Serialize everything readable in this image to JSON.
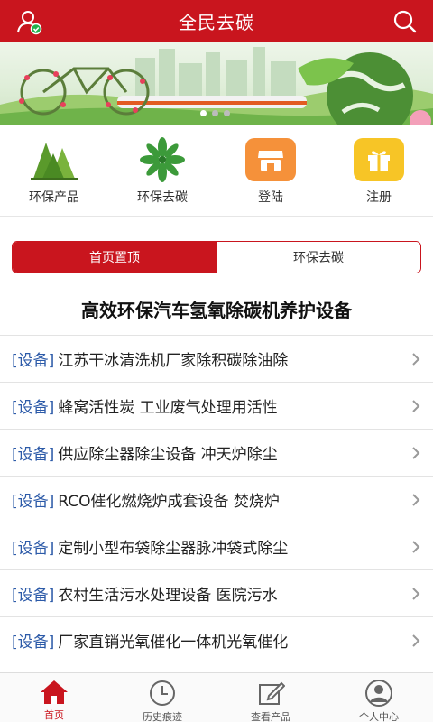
{
  "header": {
    "title": "全民去碳"
  },
  "quick_entries": [
    {
      "label": "环保产品",
      "icon": "trees-icon"
    },
    {
      "label": "环保去碳",
      "icon": "leaf-burst-icon"
    },
    {
      "label": "登陆",
      "icon": "store-icon",
      "color": "#f5913a"
    },
    {
      "label": "注册",
      "icon": "gift-icon",
      "color": "#f7c526"
    }
  ],
  "tabs": [
    {
      "label": "首页置顶",
      "active": true
    },
    {
      "label": "环保去碳",
      "active": false
    }
  ],
  "headline": "高效环保汽车氢氧除碳机养护设备",
  "list": [
    {
      "tag": "[设备]",
      "text": "江苏干冰清洗机厂家除积碳除油除"
    },
    {
      "tag": "[设备]",
      "text": "蜂窝活性炭 工业废气处理用活性"
    },
    {
      "tag": "[设备]",
      "text": "供应除尘器除尘设备 冲天炉除尘"
    },
    {
      "tag": "[设备]",
      "text": "RCO催化燃烧炉成套设备 焚烧炉"
    },
    {
      "tag": "[设备]",
      "text": "定制小型布袋除尘器脉冲袋式除尘"
    },
    {
      "tag": "[设备]",
      "text": "农村生活污水处理设备 医院污水"
    },
    {
      "tag": "[设备]",
      "text": "厂家直销光氧催化一体机光氧催化"
    }
  ],
  "bottom_nav": [
    {
      "label": "首页",
      "icon": "home-icon",
      "active": true
    },
    {
      "label": "历史痕迹",
      "icon": "clock-icon",
      "active": false
    },
    {
      "label": "查看产品",
      "icon": "edit-icon",
      "active": false
    },
    {
      "label": "个人中心",
      "icon": "person-icon",
      "active": false
    }
  ],
  "colors": {
    "brand_red": "#c9151e",
    "tag_blue": "#2c5aa8"
  }
}
